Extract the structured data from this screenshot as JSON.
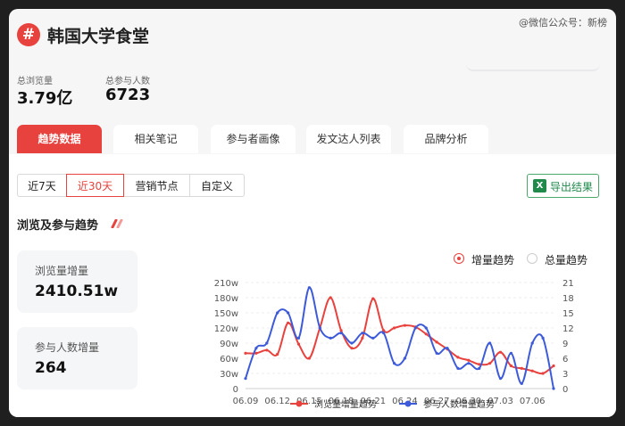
{
  "watermark": "@微信公众号：新榜",
  "header": {
    "logo": "#",
    "title": "韩国大学食堂"
  },
  "stats": [
    {
      "label": "总浏览量",
      "value": "3.79亿"
    },
    {
      "label": "总参与人数",
      "value": "6723"
    }
  ],
  "tabs": [
    "趋势数据",
    "相关笔记",
    "参与者画像",
    "发文达人列表",
    "品牌分析"
  ],
  "range_buttons": [
    "近7天",
    "近30天",
    "营销节点",
    "自定义"
  ],
  "export_label": "导出结果",
  "section_title": "浏览及参与趋势",
  "metrics": [
    {
      "label": "浏览量增量",
      "value": "2410.51w"
    },
    {
      "label": "参与人数增量",
      "value": "264"
    }
  ],
  "mode_options": [
    "增量趋势",
    "总量趋势"
  ],
  "colors": {
    "accent": "#e8423e",
    "blue": "#3d5bd9",
    "export_green": "#1f8a4c"
  },
  "chart_data": {
    "type": "line",
    "x_tick_labels": [
      "06.09",
      "06.12",
      "06.15",
      "06.18",
      "06.21",
      "06.24",
      "06.27",
      "06.30",
      "07.03",
      "07.06"
    ],
    "x": [
      "06.09",
      "06.10",
      "06.11",
      "06.12",
      "06.13",
      "06.14",
      "06.15",
      "06.16",
      "06.17",
      "06.18",
      "06.19",
      "06.20",
      "06.21",
      "06.22",
      "06.23",
      "06.24",
      "06.25",
      "06.26",
      "06.27",
      "06.28",
      "06.29",
      "06.30",
      "07.01",
      "07.02",
      "07.03",
      "07.04",
      "07.05",
      "07.06",
      "07.07",
      "07.08"
    ],
    "y_left_ticks": [
      "0",
      "30w",
      "60w",
      "90w",
      "120w",
      "150w",
      "180w",
      "210w"
    ],
    "y_right_ticks": [
      "0",
      "3",
      "6",
      "9",
      "12",
      "15",
      "18",
      "21"
    ],
    "ylim_left": [
      0,
      210
    ],
    "ylim_right": [
      0,
      21
    ],
    "series": [
      {
        "name": "浏览量增量趋势",
        "axis": "left",
        "color": "#e8423e",
        "values": [
          70,
          70,
          76,
          68,
          130,
          88,
          60,
          120,
          180,
          115,
          80,
          100,
          178,
          115,
          120,
          125,
          122,
          108,
          92,
          78,
          62,
          56,
          48,
          50,
          72,
          45,
          40,
          35,
          30,
          45
        ]
      },
      {
        "name": "参与人数增量趋势",
        "axis": "right",
        "color": "#3d5bd9",
        "values": [
          2,
          8,
          9,
          15,
          15,
          10,
          20,
          12,
          10,
          11,
          9,
          11,
          10,
          11,
          5,
          6,
          12,
          12,
          7,
          8,
          4,
          5,
          4,
          9,
          2,
          7,
          1,
          9,
          10,
          0
        ]
      }
    ]
  }
}
